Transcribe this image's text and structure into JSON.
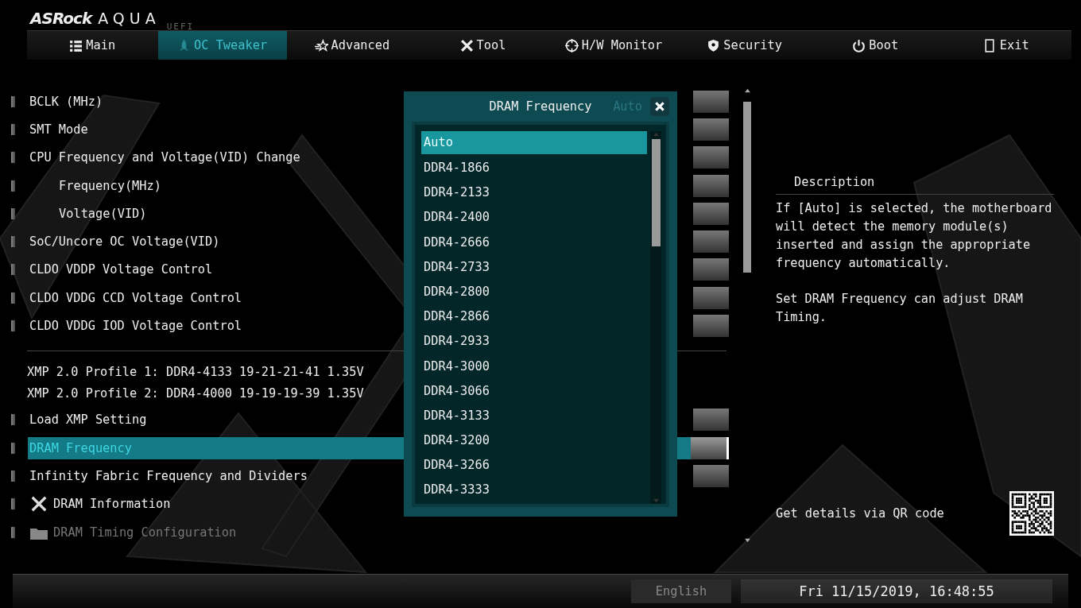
{
  "logo": {
    "brand": "ASRock",
    "product": "AQUA",
    "suffix": "UEFI"
  },
  "tabs": [
    {
      "label": "Main",
      "selected": false
    },
    {
      "label": "OC Tweaker",
      "selected": true
    },
    {
      "label": "Advanced",
      "selected": false
    },
    {
      "label": "Tool",
      "selected": false
    },
    {
      "label": "H/W Monitor",
      "selected": false
    },
    {
      "label": "Security",
      "selected": false
    },
    {
      "label": "Boot",
      "selected": false
    },
    {
      "label": "Exit",
      "selected": false
    }
  ],
  "settings": [
    {
      "kind": "setting",
      "label": "BCLK (MHz)",
      "selected": false
    },
    {
      "kind": "setting",
      "label": "SMT Mode",
      "selected": false
    },
    {
      "kind": "setting",
      "label": "CPU Frequency and Voltage(VID) Change",
      "selected": false,
      "children": [
        {
          "kind": "setting",
          "label": "Frequency(MHz)",
          "selected": false
        },
        {
          "kind": "setting",
          "label": "Voltage(VID)",
          "selected": false
        }
      ]
    },
    {
      "kind": "setting",
      "label": "SoC/Uncore OC Voltage(VID)",
      "selected": false
    },
    {
      "kind": "setting",
      "label": "CLDO VDDP Voltage Control",
      "selected": false
    },
    {
      "kind": "setting",
      "label": "CLDO VDDG CCD Voltage Control",
      "selected": false
    },
    {
      "kind": "setting",
      "label": "CLDO VDDG IOD Voltage Control",
      "selected": false
    },
    {
      "kind": "divider"
    },
    {
      "kind": "info",
      "label": "XMP 2.0 Profile 1: DDR4-4133 19-21-21-41 1.35V"
    },
    {
      "kind": "info",
      "label": "XMP 2.0 Profile 2: DDR4-4000 19-19-19-39 1.35V"
    },
    {
      "kind": "setting",
      "label": "Load XMP Setting",
      "selected": false
    },
    {
      "kind": "setting",
      "label": "DRAM Frequency",
      "selected": true
    },
    {
      "kind": "setting",
      "label": "Infinity Fabric Frequency and Dividers",
      "selected": false
    },
    {
      "kind": "tool",
      "label": "DRAM Information",
      "selected": false,
      "disabled": false
    },
    {
      "kind": "folder",
      "label": "DRAM Timing Configuration",
      "selected": false,
      "disabled": true
    }
  ],
  "dialog": {
    "title": "DRAM Frequency",
    "behind_value": "Auto",
    "options": [
      {
        "label": "Auto",
        "selected": true
      },
      {
        "label": "DDR4-1866",
        "selected": false
      },
      {
        "label": "DDR4-2133",
        "selected": false
      },
      {
        "label": "DDR4-2400",
        "selected": false
      },
      {
        "label": "DDR4-2666",
        "selected": false
      },
      {
        "label": "DDR4-2733",
        "selected": false
      },
      {
        "label": "DDR4-2800",
        "selected": false
      },
      {
        "label": "DDR4-2866",
        "selected": false
      },
      {
        "label": "DDR4-2933",
        "selected": false
      },
      {
        "label": "DDR4-3000",
        "selected": false
      },
      {
        "label": "DDR4-3066",
        "selected": false
      },
      {
        "label": "DDR4-3133",
        "selected": false
      },
      {
        "label": "DDR4-3200",
        "selected": false
      },
      {
        "label": "DDR4-3266",
        "selected": false
      },
      {
        "label": "DDR4-3333",
        "selected": false
      }
    ]
  },
  "description": {
    "heading": "Description",
    "paragraphs": [
      "If [Auto] is selected, the motherboard will detect the memory module(s) inserted and assign the appropriate frequency automatically.",
      "Set DRAM Frequency can adjust DRAM Timing."
    ],
    "qr_label": "Get details via QR code"
  },
  "status_bar": {
    "language": "English",
    "datetime": "Fri 11/15/2019, 16:48:55"
  }
}
